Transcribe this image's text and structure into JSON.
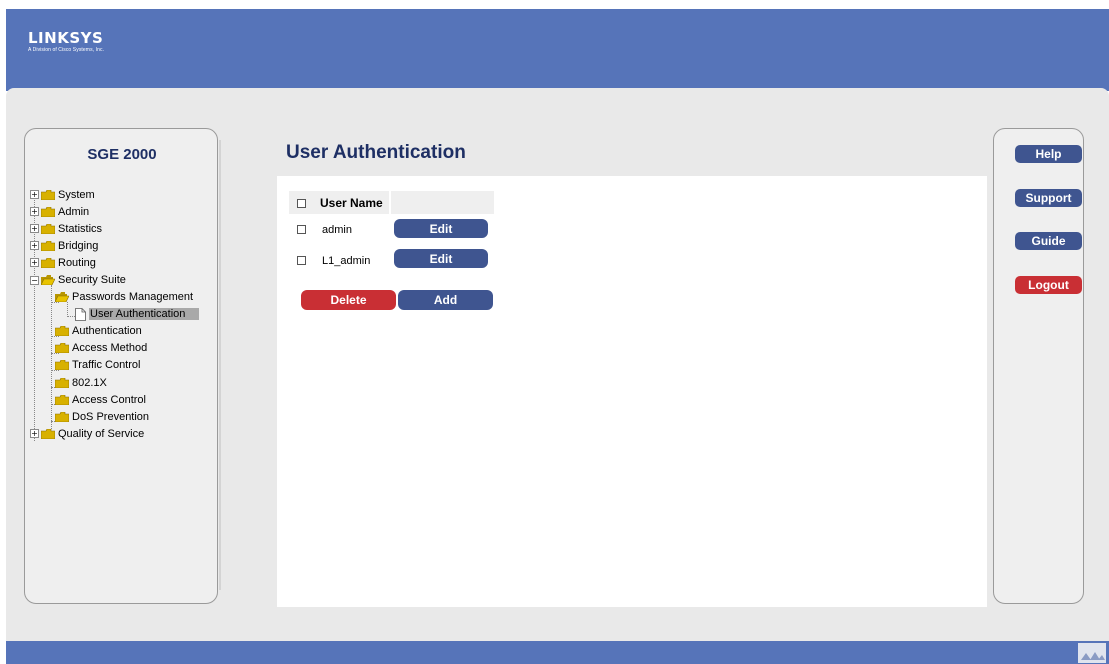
{
  "brand": {
    "name": "LINKSYS",
    "tagline": "A Division of Cisco Systems, Inc."
  },
  "device": {
    "title": "SGE 2000"
  },
  "tree": {
    "items": [
      {
        "label": "System"
      },
      {
        "label": "Admin"
      },
      {
        "label": "Statistics"
      },
      {
        "label": "Bridging"
      },
      {
        "label": "Routing"
      },
      {
        "label": "Security Suite"
      },
      {
        "label": "Passwords Management"
      },
      {
        "label": "User Authentication"
      },
      {
        "label": "Authentication"
      },
      {
        "label": "Access Method"
      },
      {
        "label": "Traffic Control"
      },
      {
        "label": "802.1X"
      },
      {
        "label": "Access Control"
      },
      {
        "label": "DoS Prevention"
      },
      {
        "label": "Quality of Service"
      }
    ]
  },
  "main": {
    "title": "User Authentication",
    "table": {
      "column_header": "User Name",
      "rows": [
        {
          "name": "admin",
          "edit_label": "Edit"
        },
        {
          "name": "L1_admin",
          "edit_label": "Edit"
        }
      ]
    },
    "delete_label": "Delete",
    "add_label": "Add"
  },
  "side": {
    "help_label": "Help",
    "support_label": "Support",
    "guide_label": "Guide",
    "logout_label": "Logout"
  },
  "colors": {
    "header_bar": "#5674b9",
    "button_blue": "#3f5590",
    "button_red": "#c92f34",
    "title_navy": "#1e2f64"
  },
  "icons": {
    "expander": "plus-box-icon",
    "folder": "folder-icon",
    "page": "page-icon"
  }
}
